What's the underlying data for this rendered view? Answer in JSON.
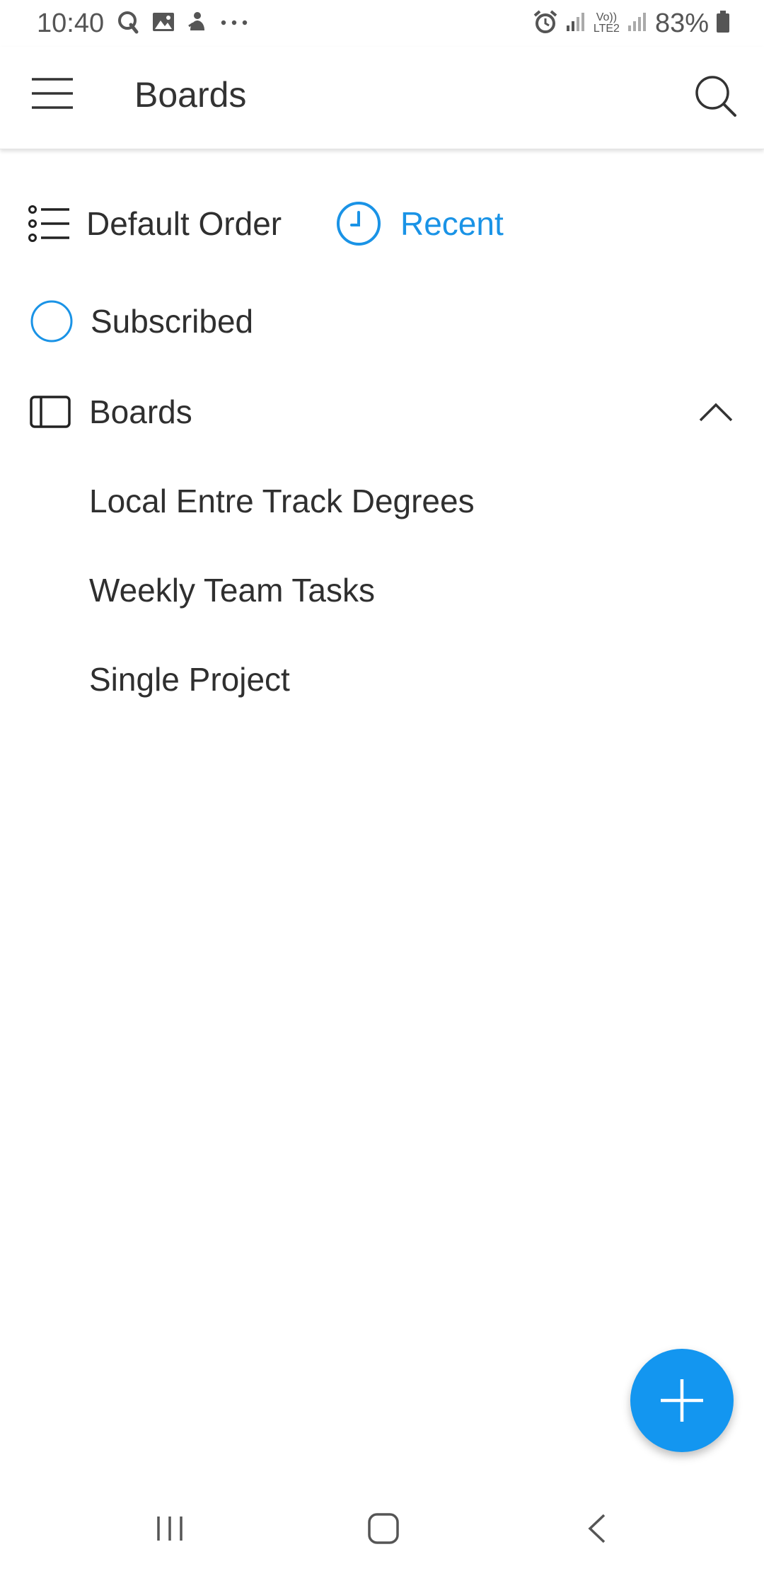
{
  "status_bar": {
    "time": "10:40",
    "battery": "83%",
    "left_icons": [
      "q-app-icon",
      "image-icon",
      "notification-icon",
      "more-dots-icon"
    ],
    "right_icons": [
      "alarm-icon",
      "signal-icon",
      "volte-icon",
      "signal-icon",
      "battery-icon"
    ],
    "volte_label": "Vo))",
    "lte_label": "LTE2"
  },
  "app_bar": {
    "title": "Boards"
  },
  "sort": {
    "default_label": "Default Order",
    "recent_label": "Recent",
    "active": "recent"
  },
  "filters": {
    "subscribed_label": "Subscribed"
  },
  "boards_section": {
    "label": "Boards",
    "expanded": true,
    "items": [
      {
        "label": "Local Entre Track Degrees"
      },
      {
        "label": "Weekly Team Tasks"
      },
      {
        "label": "Single Project"
      }
    ]
  },
  "fab": {
    "icon": "plus-icon"
  },
  "nav_bar": {
    "icons": [
      "recents-icon",
      "home-icon",
      "back-icon"
    ]
  },
  "colors": {
    "accent": "#1a93e6",
    "fab": "#1396f0",
    "text": "#2f2f2f",
    "icon": "#333333"
  }
}
